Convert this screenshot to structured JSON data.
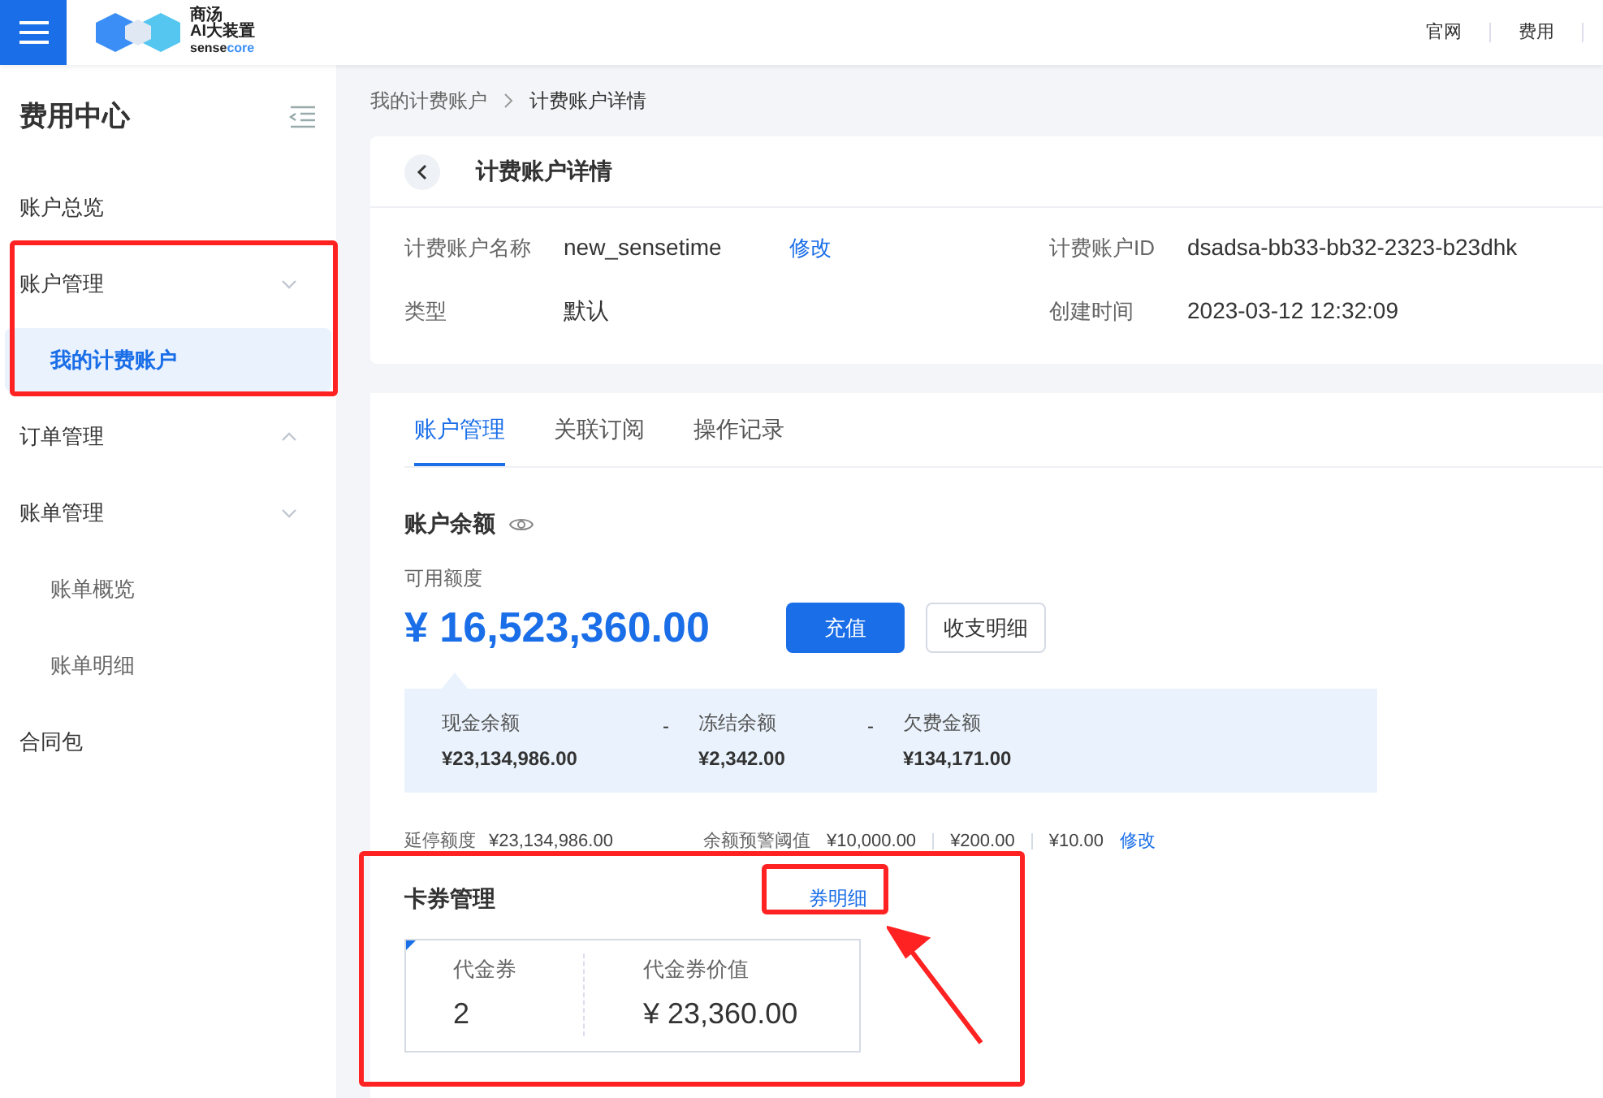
{
  "header": {
    "logo": {
      "line1": "商汤",
      "line2": "AI大装置",
      "line3_a": "sense",
      "line3_b": "core"
    },
    "links": [
      "官网",
      "费用"
    ]
  },
  "sidebar": {
    "title": "费用中心",
    "items": [
      {
        "label": "账户总览",
        "kind": "item"
      },
      {
        "label": "账户管理",
        "kind": "group",
        "expanded": true,
        "children": [
          {
            "label": "我的计费账户",
            "selected": true
          }
        ]
      },
      {
        "label": "订单管理",
        "kind": "group",
        "expanded": false
      },
      {
        "label": "账单管理",
        "kind": "group",
        "expanded": true,
        "children": [
          {
            "label": "账单概览",
            "selected": false
          },
          {
            "label": "账单明细",
            "selected": false
          }
        ]
      },
      {
        "label": "合同包",
        "kind": "item"
      }
    ]
  },
  "breadcrumb": [
    "我的计费账户",
    "计费账户详情"
  ],
  "detail": {
    "title": "计费账户详情",
    "fields": [
      {
        "label": "计费账户名称",
        "value": "new_sensetime",
        "action": "修改"
      },
      {
        "label": "计费账户ID",
        "value": "dsadsa-bb33-bb32-2323-b23dhk"
      },
      {
        "label": "类型",
        "value": "默认"
      },
      {
        "label": "创建时间",
        "value": "2023-03-12 12:32:09"
      }
    ]
  },
  "tabs": [
    {
      "label": "账户管理",
      "selected": true
    },
    {
      "label": "关联订阅",
      "selected": false
    },
    {
      "label": "操作记录",
      "selected": false
    }
  ],
  "balance": {
    "title": "账户余额",
    "available_label": "可用额度",
    "available": "¥ 16,523,360.00",
    "buttons": [
      "充值",
      "收支明细"
    ],
    "breakdown": [
      {
        "label": "现金余额",
        "value": "¥23,134,986.00"
      },
      {
        "label": "冻结余额",
        "value": "¥2,342.00"
      },
      {
        "label": "欠费金额",
        "value": "¥134,171.00"
      }
    ],
    "separator": "-",
    "credit_label": "延停额度",
    "credit": "¥23,134,986.00",
    "alert_label": "余额预警阈值",
    "alerts": [
      "¥10,000.00",
      "¥200.00",
      "¥10.00"
    ],
    "alert_action": "修改"
  },
  "coupons": {
    "title": "卡券管理",
    "link": "券明细",
    "stats": [
      {
        "label": "代金券",
        "value": "2"
      },
      {
        "label": "代金券价值",
        "value": "¥ 23,360.00"
      }
    ]
  }
}
